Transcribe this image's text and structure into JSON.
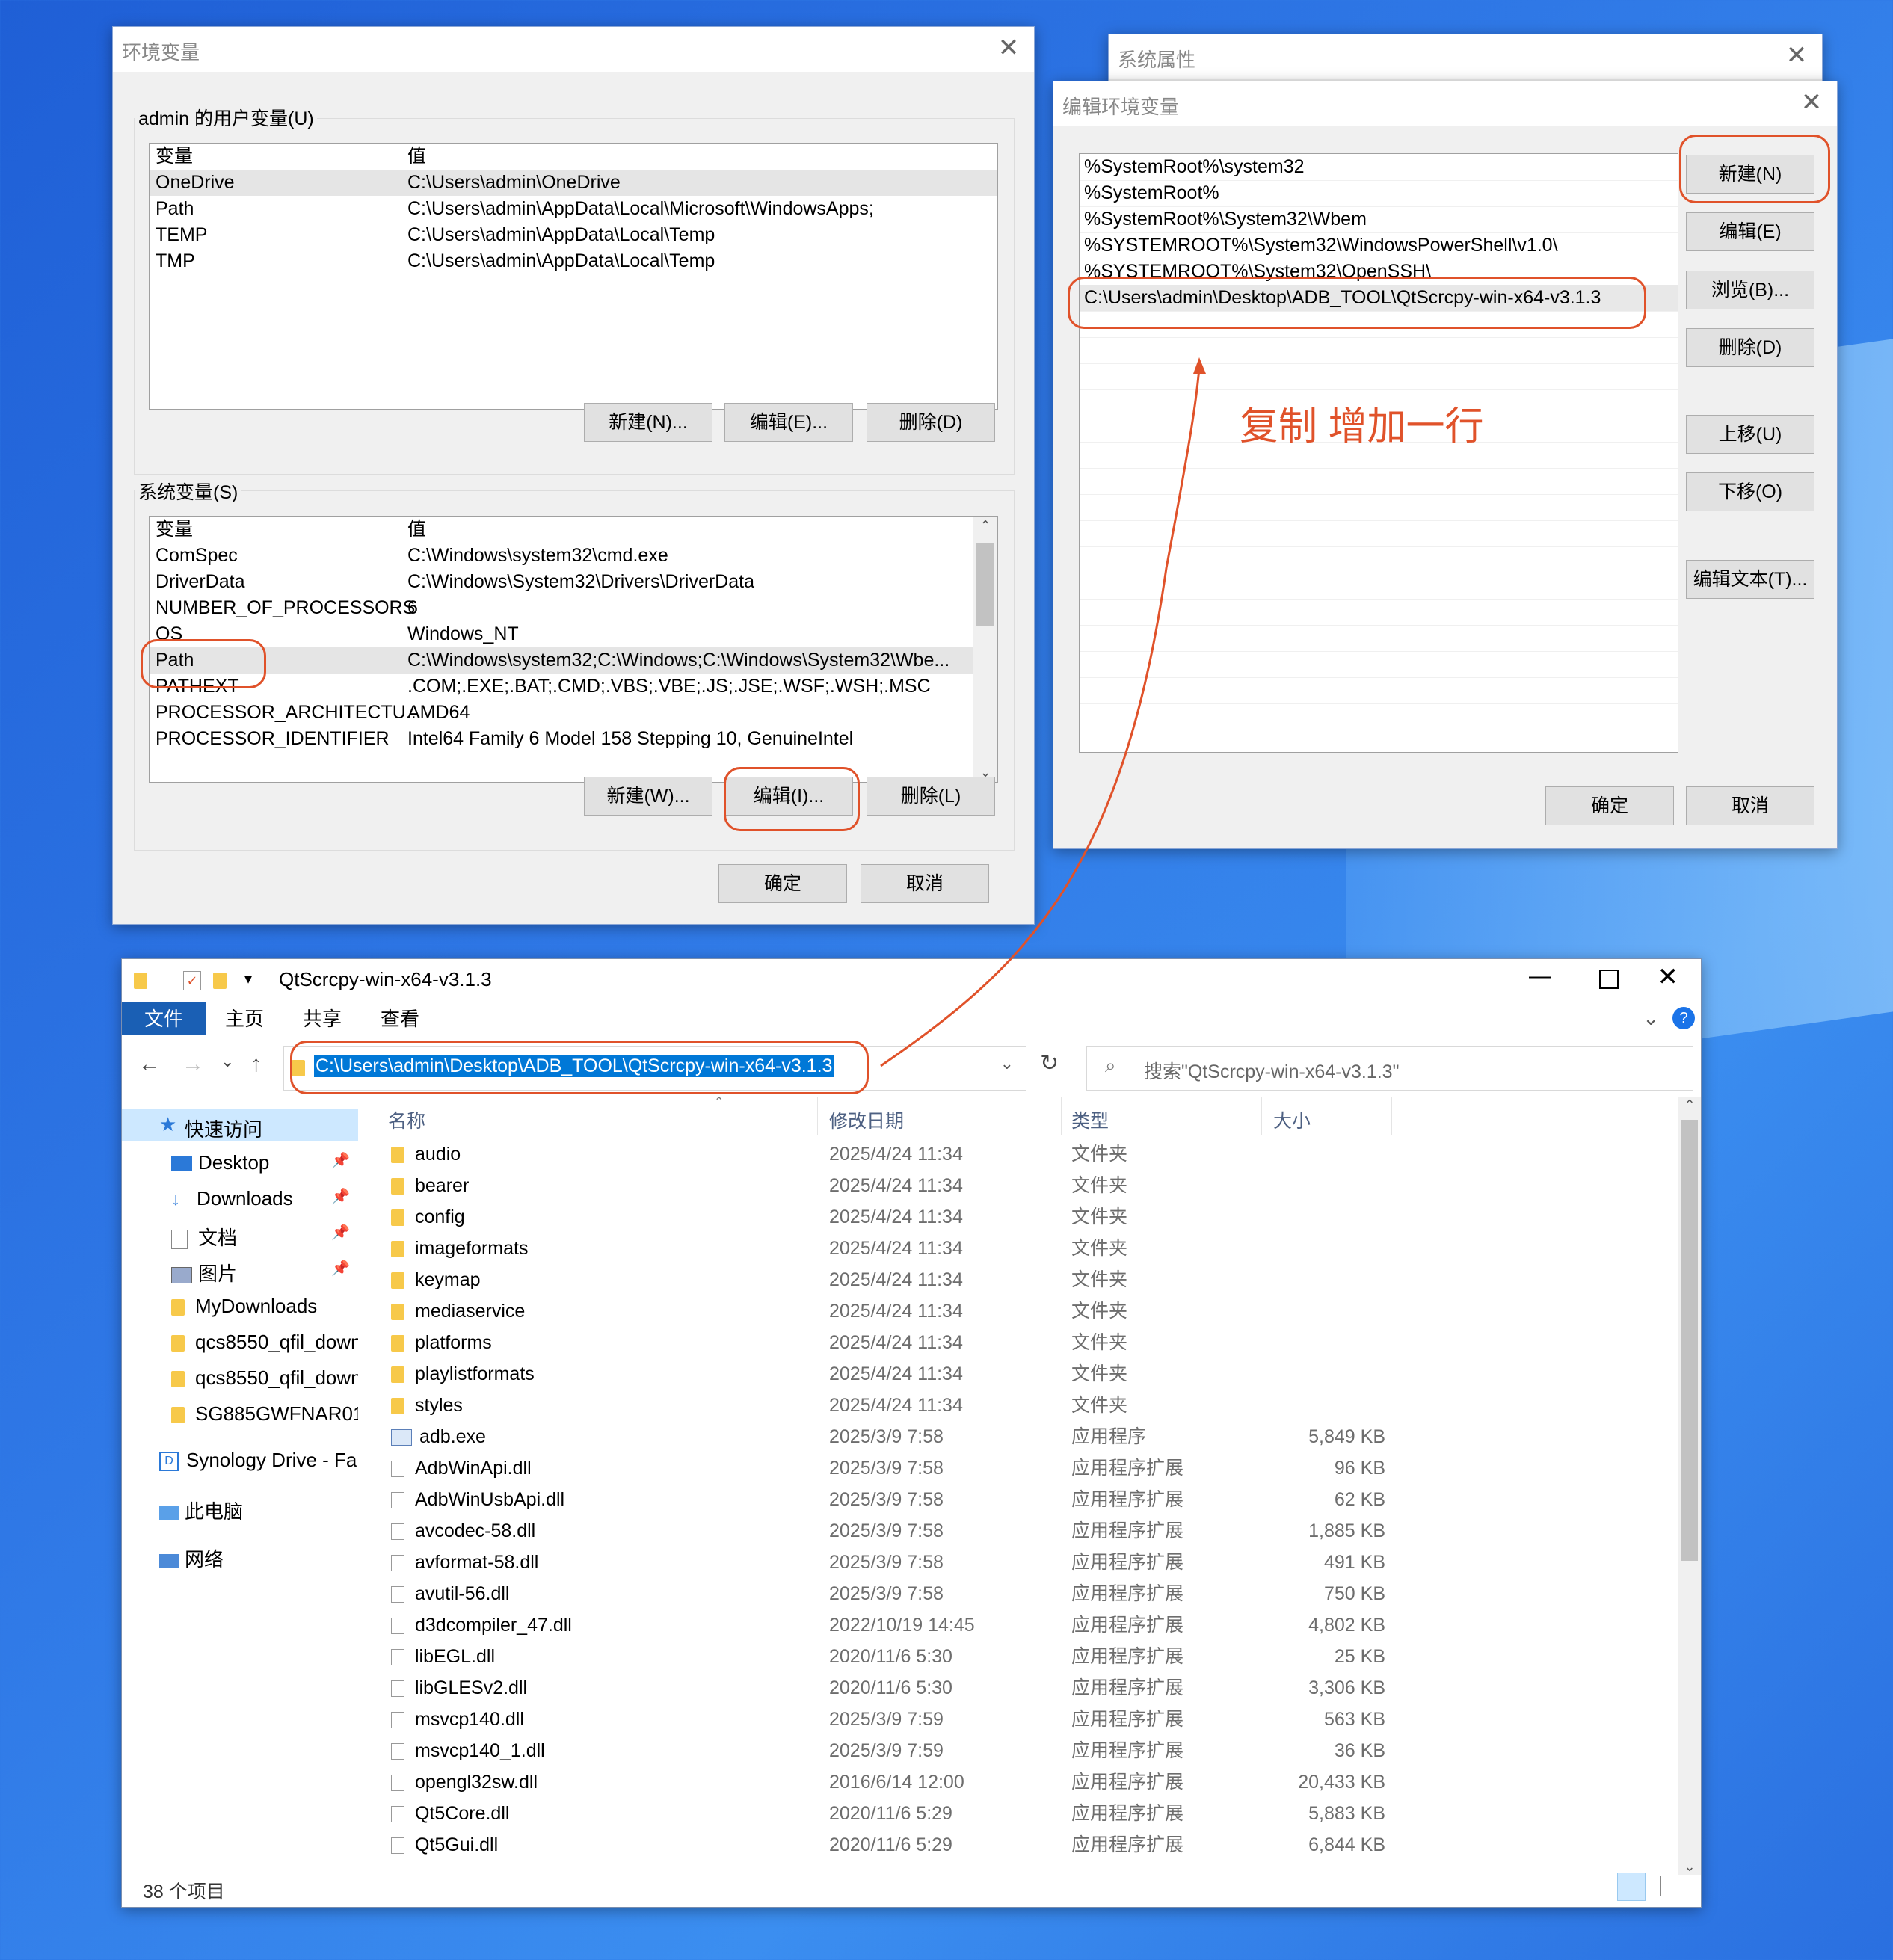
{
  "env_dialog": {
    "title": "环境变量",
    "user_group": "admin 的用户变量(U)",
    "col_var": "变量",
    "col_val": "值",
    "user_vars": [
      {
        "name": "OneDrive",
        "value": "C:\\Users\\admin\\OneDrive"
      },
      {
        "name": "Path",
        "value": "C:\\Users\\admin\\AppData\\Local\\Microsoft\\WindowsApps;"
      },
      {
        "name": "TEMP",
        "value": "C:\\Users\\admin\\AppData\\Local\\Temp"
      },
      {
        "name": "TMP",
        "value": "C:\\Users\\admin\\AppData\\Local\\Temp"
      }
    ],
    "user_new": "新建(N)...",
    "user_edit": "编辑(E)...",
    "user_delete": "删除(D)",
    "sys_group": "系统变量(S)",
    "sys_vars": [
      {
        "name": "ComSpec",
        "value": "C:\\Windows\\system32\\cmd.exe"
      },
      {
        "name": "DriverData",
        "value": "C:\\Windows\\System32\\Drivers\\DriverData"
      },
      {
        "name": "NUMBER_OF_PROCESSORS",
        "value": "6"
      },
      {
        "name": "OS",
        "value": "Windows_NT"
      },
      {
        "name": "Path",
        "value": "C:\\Windows\\system32;C:\\Windows;C:\\Windows\\System32\\Wbe..."
      },
      {
        "name": "PATHEXT",
        "value": ".COM;.EXE;.BAT;.CMD;.VBS;.VBE;.JS;.JSE;.WSF;.WSH;.MSC"
      },
      {
        "name": "PROCESSOR_ARCHITECTU...",
        "value": "AMD64"
      },
      {
        "name": "PROCESSOR_IDENTIFIER",
        "value": "Intel64 Family 6 Model 158 Stepping 10, GenuineIntel"
      }
    ],
    "sys_new": "新建(W)...",
    "sys_edit": "编辑(I)...",
    "sys_delete": "删除(L)",
    "ok": "确定",
    "cancel": "取消"
  },
  "sysprop": {
    "title": "系统属性"
  },
  "edit_dialog": {
    "title": "编辑环境变量",
    "entries": [
      "%SystemRoot%\\system32",
      "%SystemRoot%",
      "%SystemRoot%\\System32\\Wbem",
      "%SYSTEMROOT%\\System32\\WindowsPowerShell\\v1.0\\",
      "%SYSTEMROOT%\\System32\\OpenSSH\\",
      "C:\\Users\\admin\\Desktop\\ADB_TOOL\\QtScrcpy-win-x64-v3.1.3"
    ],
    "btn_new": "新建(N)",
    "btn_edit": "编辑(E)",
    "btn_browse": "浏览(B)...",
    "btn_delete": "删除(D)",
    "btn_up": "上移(U)",
    "btn_down": "下移(O)",
    "btn_edit_text": "编辑文本(T)...",
    "ok": "确定",
    "cancel": "取消"
  },
  "annotation": "复制 增加一行",
  "explorer": {
    "title": "QtScrcpy-win-x64-v3.1.3",
    "ribbon": {
      "file": "文件",
      "home": "主页",
      "share": "共享",
      "view": "查看"
    },
    "address": "C:\\Users\\admin\\Desktop\\ADB_TOOL\\QtScrcpy-win-x64-v3.1.3",
    "search_placeholder": "搜索\"QtScrcpy-win-x64-v3.1.3\"",
    "columns": {
      "name": "名称",
      "date": "修改日期",
      "type": "类型",
      "size": "大小"
    },
    "nav": {
      "quick_access": "快速访问",
      "items": [
        "Desktop",
        "Downloads",
        "文档",
        "图片",
        "MyDownloads",
        "qcs8550_qfil_down",
        "qcs8550_qfil_down",
        "SG885GWFNAR01"
      ],
      "synology": "Synology Drive - Fa",
      "this_pc": "此电脑",
      "network": "网络"
    },
    "files": [
      {
        "name": "audio",
        "date": "2025/4/24 11:34",
        "type": "文件夹",
        "size": "",
        "kind": "folder"
      },
      {
        "name": "bearer",
        "date": "2025/4/24 11:34",
        "type": "文件夹",
        "size": "",
        "kind": "folder"
      },
      {
        "name": "config",
        "date": "2025/4/24 11:34",
        "type": "文件夹",
        "size": "",
        "kind": "folder"
      },
      {
        "name": "imageformats",
        "date": "2025/4/24 11:34",
        "type": "文件夹",
        "size": "",
        "kind": "folder"
      },
      {
        "name": "keymap",
        "date": "2025/4/24 11:34",
        "type": "文件夹",
        "size": "",
        "kind": "folder"
      },
      {
        "name": "mediaservice",
        "date": "2025/4/24 11:34",
        "type": "文件夹",
        "size": "",
        "kind": "folder"
      },
      {
        "name": "platforms",
        "date": "2025/4/24 11:34",
        "type": "文件夹",
        "size": "",
        "kind": "folder"
      },
      {
        "name": "playlistformats",
        "date": "2025/4/24 11:34",
        "type": "文件夹",
        "size": "",
        "kind": "folder"
      },
      {
        "name": "styles",
        "date": "2025/4/24 11:34",
        "type": "文件夹",
        "size": "",
        "kind": "folder"
      },
      {
        "name": "adb.exe",
        "date": "2025/3/9 7:58",
        "type": "应用程序",
        "size": "5,849 KB",
        "kind": "exe"
      },
      {
        "name": "AdbWinApi.dll",
        "date": "2025/3/9 7:58",
        "type": "应用程序扩展",
        "size": "96 KB",
        "kind": "dll"
      },
      {
        "name": "AdbWinUsbApi.dll",
        "date": "2025/3/9 7:58",
        "type": "应用程序扩展",
        "size": "62 KB",
        "kind": "dll"
      },
      {
        "name": "avcodec-58.dll",
        "date": "2025/3/9 7:58",
        "type": "应用程序扩展",
        "size": "1,885 KB",
        "kind": "dll"
      },
      {
        "name": "avformat-58.dll",
        "date": "2025/3/9 7:58",
        "type": "应用程序扩展",
        "size": "491 KB",
        "kind": "dll"
      },
      {
        "name": "avutil-56.dll",
        "date": "2025/3/9 7:58",
        "type": "应用程序扩展",
        "size": "750 KB",
        "kind": "dll"
      },
      {
        "name": "d3dcompiler_47.dll",
        "date": "2022/10/19 14:45",
        "type": "应用程序扩展",
        "size": "4,802 KB",
        "kind": "dll"
      },
      {
        "name": "libEGL.dll",
        "date": "2020/11/6 5:30",
        "type": "应用程序扩展",
        "size": "25 KB",
        "kind": "dll"
      },
      {
        "name": "libGLESv2.dll",
        "date": "2020/11/6 5:30",
        "type": "应用程序扩展",
        "size": "3,306 KB",
        "kind": "dll"
      },
      {
        "name": "msvcp140.dll",
        "date": "2025/3/9 7:59",
        "type": "应用程序扩展",
        "size": "563 KB",
        "kind": "dll"
      },
      {
        "name": "msvcp140_1.dll",
        "date": "2025/3/9 7:59",
        "type": "应用程序扩展",
        "size": "36 KB",
        "kind": "dll"
      },
      {
        "name": "opengl32sw.dll",
        "date": "2016/6/14 12:00",
        "type": "应用程序扩展",
        "size": "20,433 KB",
        "kind": "dll"
      },
      {
        "name": "Qt5Core.dll",
        "date": "2020/11/6 5:29",
        "type": "应用程序扩展",
        "size": "5,883 KB",
        "kind": "dll"
      },
      {
        "name": "Qt5Gui.dll",
        "date": "2020/11/6 5:29",
        "type": "应用程序扩展",
        "size": "6,844 KB",
        "kind": "dll"
      }
    ],
    "status": "38 个项目"
  }
}
